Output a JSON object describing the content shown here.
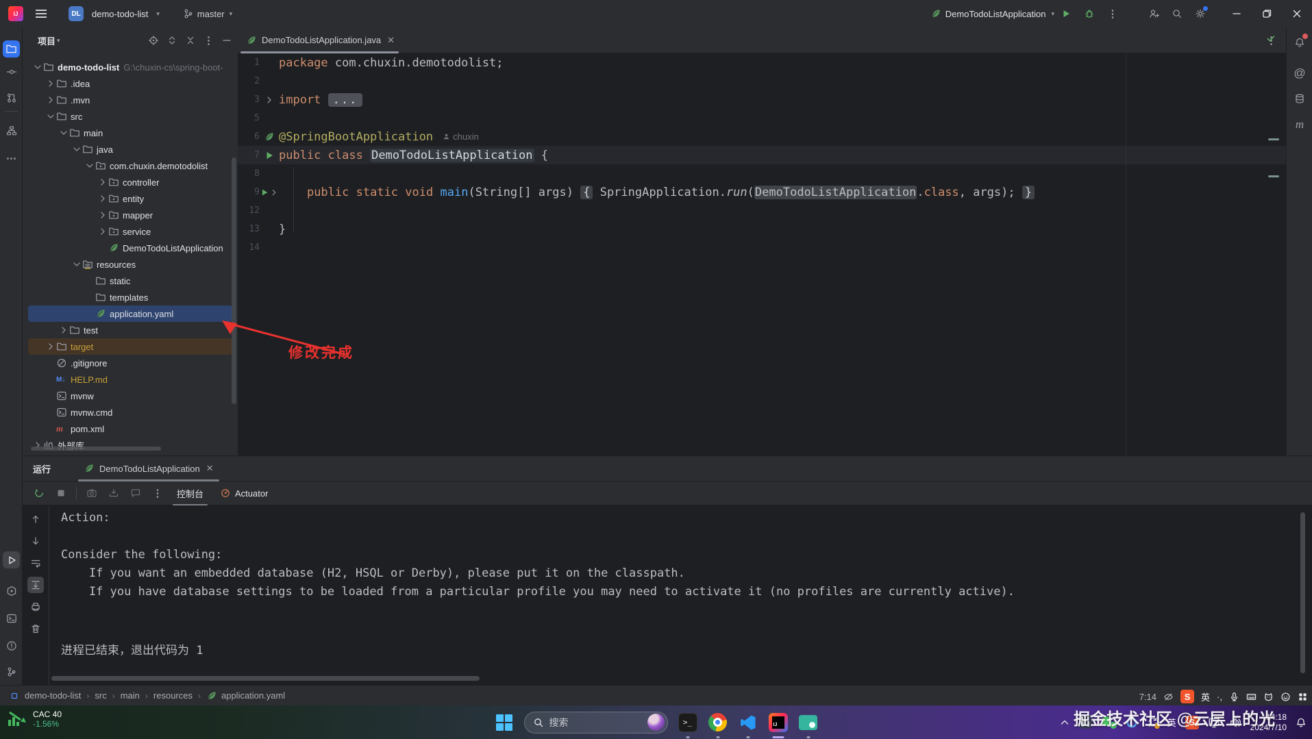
{
  "colors": {
    "accent": "#3574F0",
    "selection": "#2E436E",
    "run_green": "#5FAD65",
    "keyword_orange": "#CF8E6D",
    "annotation_yellow": "#B3AE60",
    "method_blue": "#56A8F5",
    "excluded_row": "#443527",
    "excluded_text": "#C8A038",
    "annotation_red": "#E8322E",
    "editor_bg": "#1E1F22",
    "panel_bg": "#2B2D30",
    "stock_green": "#4CC38A"
  },
  "title_bar": {
    "project_badge": "DL",
    "project_name": "demo-todo-list",
    "branch": "master",
    "run_config": "DemoTodoListApplication"
  },
  "project_panel": {
    "title": "项目",
    "tree": [
      {
        "lvl": 0,
        "ch": "d",
        "ic": "folder",
        "lb": "demo-todo-list",
        "bold": true,
        "extra": "G:\\chuxin-cs\\spring-boot-"
      },
      {
        "lvl": 1,
        "ch": "r",
        "ic": "folder",
        "lb": ".idea"
      },
      {
        "lvl": 1,
        "ch": "r",
        "ic": "folder",
        "lb": ".mvn"
      },
      {
        "lvl": 1,
        "ch": "d",
        "ic": "folder",
        "lb": "src"
      },
      {
        "lvl": 2,
        "ch": "d",
        "ic": "folder",
        "lb": "main"
      },
      {
        "lvl": 3,
        "ch": "d",
        "ic": "folder",
        "lb": "java"
      },
      {
        "lvl": 4,
        "ch": "d",
        "ic": "package",
        "lb": "com.chuxin.demotodolist"
      },
      {
        "lvl": 5,
        "ch": "r",
        "ic": "package",
        "lb": "controller"
      },
      {
        "lvl": 5,
        "ch": "r",
        "ic": "package",
        "lb": "entity"
      },
      {
        "lvl": 5,
        "ch": "r",
        "ic": "package",
        "lb": "mapper"
      },
      {
        "lvl": 5,
        "ch": "r",
        "ic": "package",
        "lb": "service"
      },
      {
        "lvl": 5,
        "ch": null,
        "ic": "leaf",
        "lb": "DemoTodoListApplication"
      },
      {
        "lvl": 3,
        "ch": "d",
        "ic": "resources",
        "lb": "resources"
      },
      {
        "lvl": 4,
        "ch": null,
        "ic": "folder",
        "lb": "static"
      },
      {
        "lvl": 4,
        "ch": null,
        "ic": "folder",
        "lb": "templates"
      },
      {
        "lvl": 4,
        "ch": null,
        "ic": "leaf",
        "lb": "application.yaml",
        "sel": true
      },
      {
        "lvl": 2,
        "ch": "r",
        "ic": "folder",
        "lb": "test"
      },
      {
        "lvl": 1,
        "ch": "r",
        "ic": "folder",
        "lb": "target",
        "scope": true,
        "warm": true
      },
      {
        "lvl": 1,
        "ch": null,
        "ic": "ignore",
        "lb": ".gitignore"
      },
      {
        "lvl": 1,
        "ch": null,
        "ic": "md",
        "lb": "HELP.md",
        "warm": true
      },
      {
        "lvl": 1,
        "ch": null,
        "ic": "term",
        "lb": "mvnw"
      },
      {
        "lvl": 1,
        "ch": null,
        "ic": "term",
        "lb": "mvnw.cmd"
      },
      {
        "lvl": 1,
        "ch": null,
        "ic": "maven",
        "lb": "pom.xml"
      },
      {
        "lvl": 0,
        "ch": "r",
        "ic": "library",
        "lb": "外部库"
      }
    ]
  },
  "editor": {
    "tab_title": "DemoTodoListApplication.java",
    "lines": [
      {
        "num": "1",
        "tokens": [
          [
            "kw",
            "package"
          ],
          [
            "pl",
            " com.chuxin.demotodolist;"
          ]
        ]
      },
      {
        "num": "2",
        "tokens": []
      },
      {
        "num": "3",
        "gutter": "chevR",
        "tokens": [
          [
            "kw",
            "import"
          ],
          [
            "pl",
            " "
          ],
          [
            "fold",
            "..."
          ]
        ]
      },
      {
        "num": "5",
        "tokens": []
      },
      {
        "num": "6",
        "gutter": "leaf",
        "tokens": [
          [
            "ann",
            "@SpringBootApplication"
          ],
          [
            "author",
            "chuxin"
          ]
        ]
      },
      {
        "num": "7",
        "gutter": "play",
        "current": true,
        "tokens": [
          [
            "kw",
            "public"
          ],
          [
            "pl",
            " "
          ],
          [
            "kw",
            "class"
          ],
          [
            "pl",
            " "
          ],
          [
            "name",
            "DemoTodoListApplication"
          ],
          [
            "pl",
            " {"
          ]
        ]
      },
      {
        "num": "8",
        "tokens": []
      },
      {
        "num": "9",
        "gutter": "play2",
        "tokens": [
          [
            "pl",
            "    "
          ],
          [
            "kw",
            "public"
          ],
          [
            "pl",
            " "
          ],
          [
            "kw",
            "static"
          ],
          [
            "pl",
            " "
          ],
          [
            "kw",
            "void"
          ],
          [
            "pl",
            " "
          ],
          [
            "mth",
            "main"
          ],
          [
            "pl",
            "(String[] args) "
          ],
          [
            "brace",
            "{"
          ],
          [
            "pl",
            " SpringApplication."
          ],
          [
            "it",
            "run"
          ],
          [
            "pl",
            "("
          ],
          [
            "hl",
            "DemoTodoListApplication"
          ],
          [
            "pl",
            "."
          ],
          [
            "kw",
            "class"
          ],
          [
            "pl",
            ", args); "
          ],
          [
            "brace",
            "}"
          ]
        ]
      },
      {
        "num": "12",
        "tokens": []
      },
      {
        "num": "13",
        "tokens": [
          [
            "pl",
            "}"
          ]
        ]
      },
      {
        "num": "14",
        "tokens": []
      }
    ]
  },
  "run_panel": {
    "tool_label": "运行",
    "tab_title": "DemoTodoListApplication",
    "console_tab": "控制台",
    "actuator_tab": "Actuator",
    "console_lines": [
      "Action:",
      "",
      "Consider the following:",
      "    If you want an embedded database (H2, HSQL or Derby), please put it on the classpath.",
      "    If you have database settings to be loaded from a particular profile you may need to activate it (no profiles are currently active).",
      "",
      "",
      "进程已结束，退出代码为 1"
    ]
  },
  "status_bar": {
    "breadcrumbs": [
      "demo-todo-list",
      "src",
      "main",
      "resources",
      "application.yaml"
    ]
  },
  "annotation_text": "修改完成",
  "watermark": "掘金技术社区 @云层上的光",
  "overlay_bar": {
    "rec_time": "7:14",
    "ime": "英"
  },
  "taskbar": {
    "stock_name": "CAC 40",
    "stock_change": "-1.56%",
    "search_placeholder": "搜索",
    "ime": "英",
    "time": "14:18",
    "date": "2024/7/10"
  }
}
